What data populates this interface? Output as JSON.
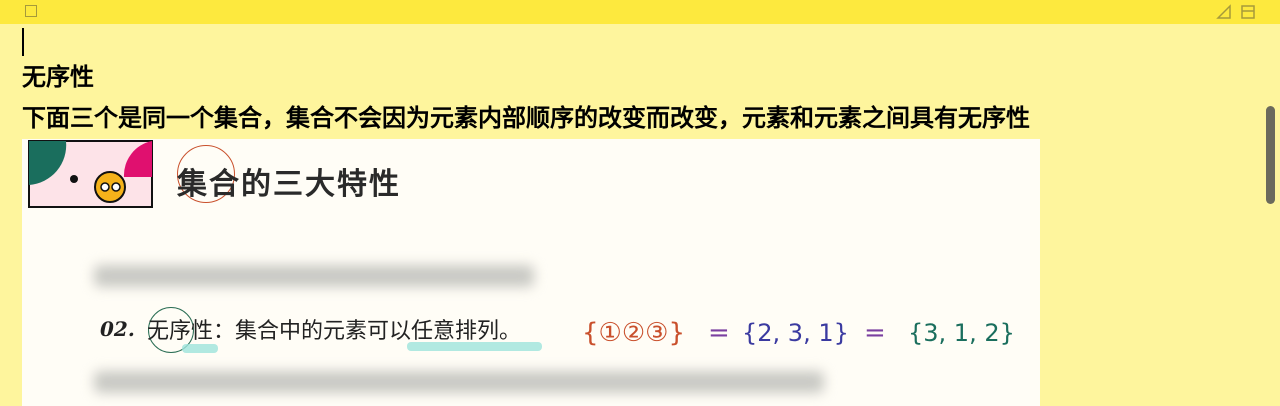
{
  "window": {
    "titlebar_color": "#fde93e",
    "background_color": "#fef59d",
    "icons": [
      "close-square-icon",
      "resize-icon",
      "window-icon"
    ]
  },
  "note": {
    "heading": "无序性",
    "body": "下面三个是同一个集合，集合不会因为元素内部顺序的改变而改变，元素和元素之间具有无序性"
  },
  "embedded_image": {
    "title": "集合的三大特性",
    "item_number": "02.",
    "item_text": "无序性：集合中的元素可以任意排列。",
    "set1": "{①②③}",
    "eq1": "=",
    "set2": "{2, 3, 1}",
    "eq2": "=",
    "set3": "{3, 1, 2}"
  }
}
